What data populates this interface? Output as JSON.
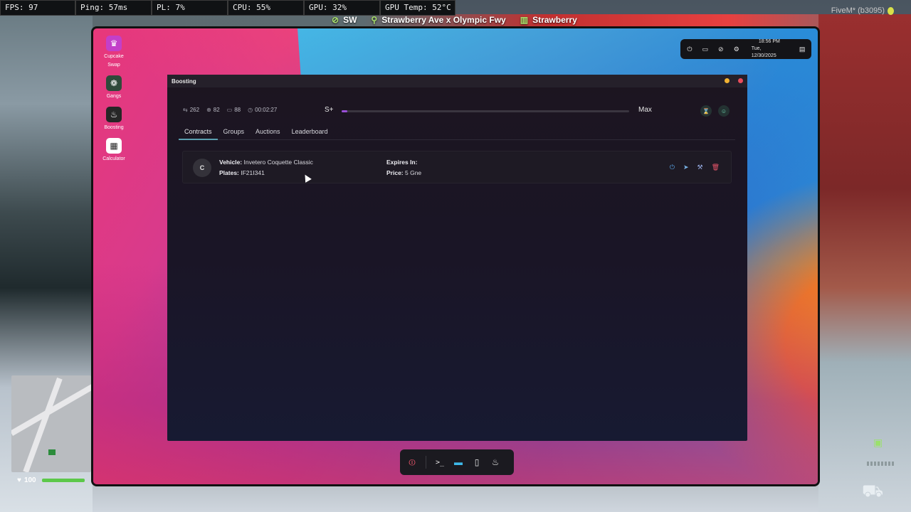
{
  "perf": {
    "fps": "FPS: 97",
    "ping": "Ping: 57ms",
    "pl": "PL: 7%",
    "cpu": "CPU: 55%",
    "gpu": "GPU: 32%",
    "gpu_temp": "GPU Temp: 52°C"
  },
  "street": {
    "direction": "SW",
    "street_name": "Strawberry Ave x Olympic Fwy",
    "area": "Strawberry"
  },
  "client_tag": "FiveM* (b3095)",
  "desktop": {
    "icons": [
      {
        "label": "Cupcake Swap",
        "icon": "cupcake-icon"
      },
      {
        "label": "Gangs",
        "icon": "gangs-icon"
      },
      {
        "label": "Boosting",
        "icon": "flame-icon"
      },
      {
        "label": "Calculator",
        "icon": "calculator-icon"
      }
    ]
  },
  "system": {
    "time": "18:56 PM",
    "date": "Tue, 12/30/2025"
  },
  "window": {
    "title": "Boosting",
    "stats": {
      "contracts": "262",
      "completed": "82",
      "vehicles": "88",
      "timer": "00:02:27"
    },
    "level": {
      "current": "S+",
      "next": "Max",
      "progress": 0.02
    },
    "tabs": [
      {
        "label": "Contracts",
        "active": true
      },
      {
        "label": "Groups",
        "active": false
      },
      {
        "label": "Auctions",
        "active": false
      },
      {
        "label": "Leaderboard",
        "active": false
      }
    ],
    "contracts": [
      {
        "class": "C",
        "vehicle_label": "Vehicle:",
        "vehicle": "Invetero Coquette Classic",
        "plates_label": "Plates:",
        "plates": "IF21I341",
        "expires_label": "Expires In:",
        "expires": "",
        "price_label": "Price:",
        "price": "5 Gne"
      }
    ]
  },
  "hud": {
    "health": "100"
  },
  "colors": {
    "accent": "#5a9fb0",
    "progress": "#9a4fd8",
    "delete": "#e8556a"
  }
}
